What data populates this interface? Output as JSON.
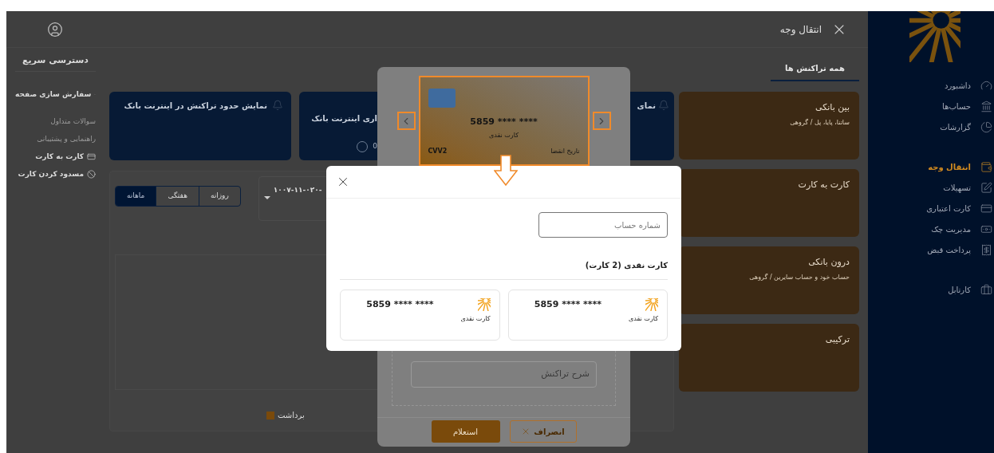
{
  "header": {
    "title": "انتقال وجه"
  },
  "nav": {
    "groups": [
      [
        {
          "label": "داشبورد",
          "selected": false
        },
        {
          "label": "حساب‌ها",
          "selected": false
        },
        {
          "label": "گزارشات",
          "selected": false
        }
      ],
      [
        {
          "label": "انتقال وجه",
          "selected": true
        },
        {
          "label": "تسهیلات",
          "selected": false
        },
        {
          "label": "کارت اعتباری",
          "selected": false
        },
        {
          "label": "مدیریت چک",
          "selected": false
        },
        {
          "label": "پرداخت قبض",
          "selected": false
        }
      ],
      [
        {
          "label": "کارتابل",
          "selected": false
        }
      ]
    ]
  },
  "tabs": [
    {
      "label": "همه تراکنش ها",
      "selected": true
    }
  ],
  "transfer_types": [
    {
      "title": "بین بانکی",
      "subtitle": "ساتنا، پایا، پل / گروهی"
    },
    {
      "title": "کارت به کارت"
    },
    {
      "title": "درون بانکی",
      "subtitle": "حساب خود و حساب سایرین / گروهی"
    },
    {
      "title": "ترکیبی"
    }
  ],
  "quick_access": {
    "title": "دسترسی سریع",
    "items": [
      {
        "label": "سفارش سازی صفحه",
        "disabled": false
      },
      {
        "label": "سوالات متداول",
        "disabled": true
      },
      {
        "label": "راهنمایی و پشتیبانی",
        "disabled": true
      },
      {
        "label": "کارت به کارت",
        "disabled": false
      },
      {
        "label": "مسدود کردن کارت",
        "disabled": false
      }
    ]
  },
  "info_cards": [
    {
      "title": "نمایش حدود تراکنش در اینترنت بانک"
    },
    {
      "title": "اری اینترنت بانک",
      "value": "0"
    },
    {
      "title": "نمای"
    }
  ],
  "period_tabs": [
    {
      "label": "روزانه",
      "selected": false
    },
    {
      "label": "هفتگی",
      "selected": false
    },
    {
      "label": "ماهانه",
      "selected": true
    }
  ],
  "account_select": {
    "value": "۱۰۰۷-۱۱-۰۲۰-"
  },
  "legend": [
    {
      "label": "برداشت",
      "color": "#7a4a0b"
    }
  ],
  "transfer_dialog": {
    "card": {
      "number": "5859 **** ****",
      "type": "کارت نقدی",
      "expiry_label": "تاریخ انقضا",
      "cvv_label": "CVV2"
    },
    "description": {
      "placeholder": "شرح تراکنش"
    },
    "buttons": [
      {
        "label": "انصراف",
        "kind": "secondary"
      },
      {
        "label": "استعلام",
        "kind": "primary"
      }
    ]
  },
  "card_picker": {
    "search": {
      "placeholder": "شماره حساب"
    },
    "group_title": "کارت نقدی (2 کارت)",
    "cards": [
      {
        "number": "5859 **** ****",
        "type": "کارت نقدی"
      },
      {
        "number": "5859 **** ****",
        "type": "کارت نقدی"
      }
    ]
  }
}
